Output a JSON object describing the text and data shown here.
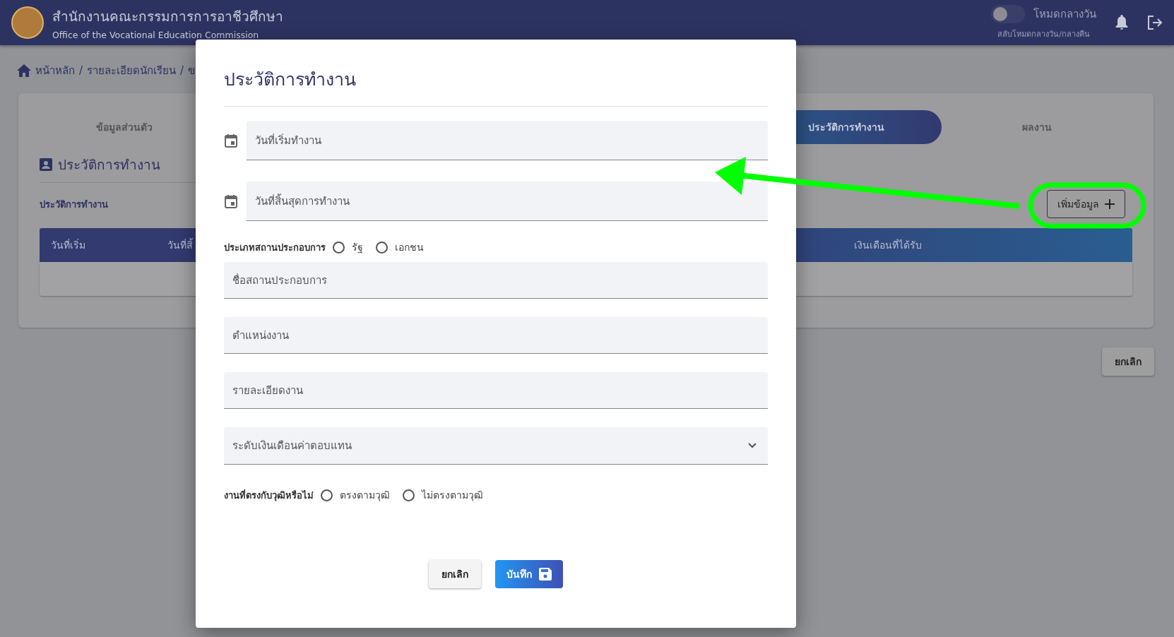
{
  "header": {
    "title": "สำนักงานคณะกรรมการการอาชีวศึกษา",
    "subtitle": "Office of the Vocational Education Commission",
    "theme_toggle": {
      "label": "โหมดกลางวัน",
      "hint": "สลับโหมดกลางวัน/กลางคืน",
      "on": false
    }
  },
  "breadcrumb": {
    "separator": "/",
    "items": [
      "หน้าหลัก",
      "รายละเอียดนักเรียน",
      "ข"
    ]
  },
  "tabs": [
    {
      "label": "ข้อมูลส่วนตัว",
      "selected": false
    },
    {
      "label": "ประวัติการทำงาน",
      "selected": true
    },
    {
      "label": "ผลงาน",
      "selected": false
    }
  ],
  "section_title": "ประวัติการทำงาน",
  "subsection_title": "ประวัติการทำงาน",
  "add_button": "เพิ่มข้อมูล",
  "table": {
    "columns": [
      "วันที่เริ่ม",
      "วันที่สิ้",
      "เงินเดือนที่ได้รับ"
    ]
  },
  "page_cancel_button": "ยกเลิก",
  "dialog": {
    "title": "ประวัติการทำงาน",
    "date_fields": [
      {
        "placeholder": "วันที่เริ่มทำงาน"
      },
      {
        "placeholder": "วันที่สิ้นสุดการทำงาน"
      }
    ],
    "workplace_type": {
      "label": "ประเภทสถานประกอบการ",
      "options": [
        {
          "label": "รัฐ",
          "selected": false
        },
        {
          "label": "เอกชน",
          "selected": false
        }
      ]
    },
    "text_fields": [
      {
        "placeholder": "ชื่อสถานประกอบการ"
      },
      {
        "placeholder": "ตำแหน่งงาน"
      },
      {
        "placeholder": "รายละเอียดงาน"
      }
    ],
    "salary_select": {
      "placeholder": "ระดับเงินเดือนค่าตอบแทน"
    },
    "qualification_match": {
      "label": "งานที่ตรงกับวุฒิหรือไม่",
      "options": [
        {
          "label": "ตรงตามวุฒิ",
          "selected": false
        },
        {
          "label": "ไม่ตรงตามวุฒิ",
          "selected": false
        }
      ]
    },
    "buttons": {
      "cancel": "ยกเลิก",
      "save": "บันทึก"
    }
  }
}
